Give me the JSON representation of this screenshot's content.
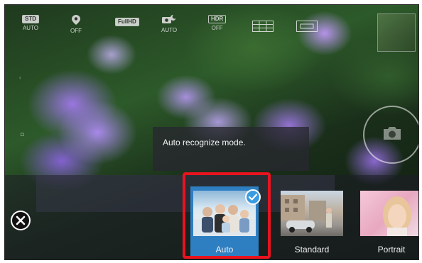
{
  "top_bar": {
    "std_badge": "STD",
    "std_label": "AUTO",
    "gps_label": "OFF",
    "resolution_badge": "FullHD",
    "night_label": "AUTO",
    "hdr_badge": "HDR",
    "hdr_label": "OFF"
  },
  "tooltip": {
    "text": "Auto recognize mode."
  },
  "modes": [
    {
      "label": "Auto",
      "selected": true
    },
    {
      "label": "Standard",
      "selected": false
    },
    {
      "label": "Portrait",
      "selected": false
    }
  ],
  "colors": {
    "selected_mode_bg": "#2e7fc2",
    "highlight_border": "#e8131f",
    "check_badge": "#3b9be0"
  },
  "icons": [
    "close-icon",
    "check-icon",
    "location-pin-icon",
    "grid-icon",
    "camera-icon"
  ]
}
